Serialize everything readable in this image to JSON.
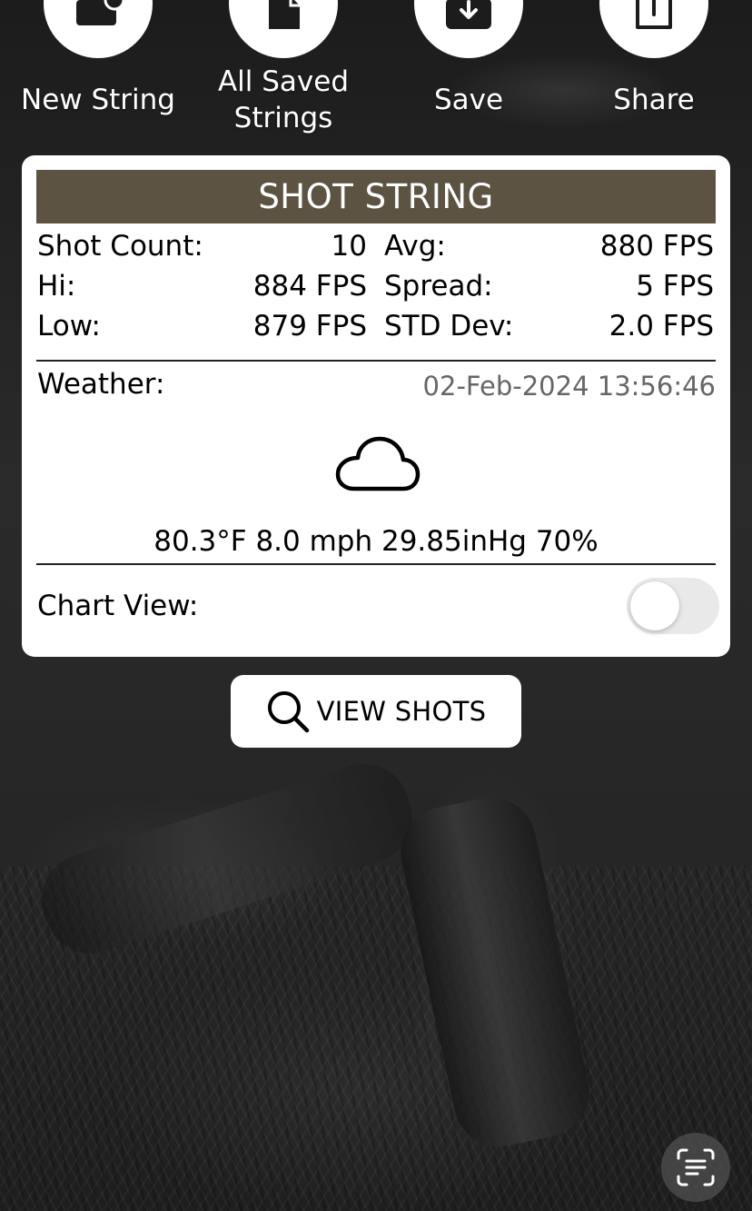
{
  "actions": [
    {
      "label": "New String",
      "icon": "new-string-icon"
    },
    {
      "label": "All Saved Strings",
      "icon": "copy-icon"
    },
    {
      "label": "Save",
      "icon": "save-icon"
    },
    {
      "label": "Share",
      "icon": "share-icon"
    }
  ],
  "card": {
    "title": "SHOT STRING",
    "stats": {
      "shot_count_label": "Shot Count:",
      "shot_count_value": "10",
      "avg_label": "Avg:",
      "avg_value": "880 FPS",
      "hi_label": "Hi:",
      "hi_value": "884 FPS",
      "spread_label": "Spread:",
      "spread_value": "5 FPS",
      "low_label": "Low:",
      "low_value": "879 FPS",
      "std_label": "STD Dev:",
      "std_value": "2.0 FPS"
    },
    "weather": {
      "label": "Weather:",
      "timestamp": "02-Feb-2024 13:56:46",
      "icon": "cloud-icon",
      "conditions": "80.3°F 8.0 mph 29.85inHg 70%"
    },
    "chart_view": {
      "label": "Chart View:",
      "enabled": false
    }
  },
  "view_shots": {
    "label": "VIEW SHOTS",
    "icon": "search-icon"
  },
  "scan_button": {
    "icon": "scan-text-icon"
  },
  "colors": {
    "header_bg": "#5c5343",
    "background": "#262626",
    "toggle_off": "#e9e9ea"
  }
}
